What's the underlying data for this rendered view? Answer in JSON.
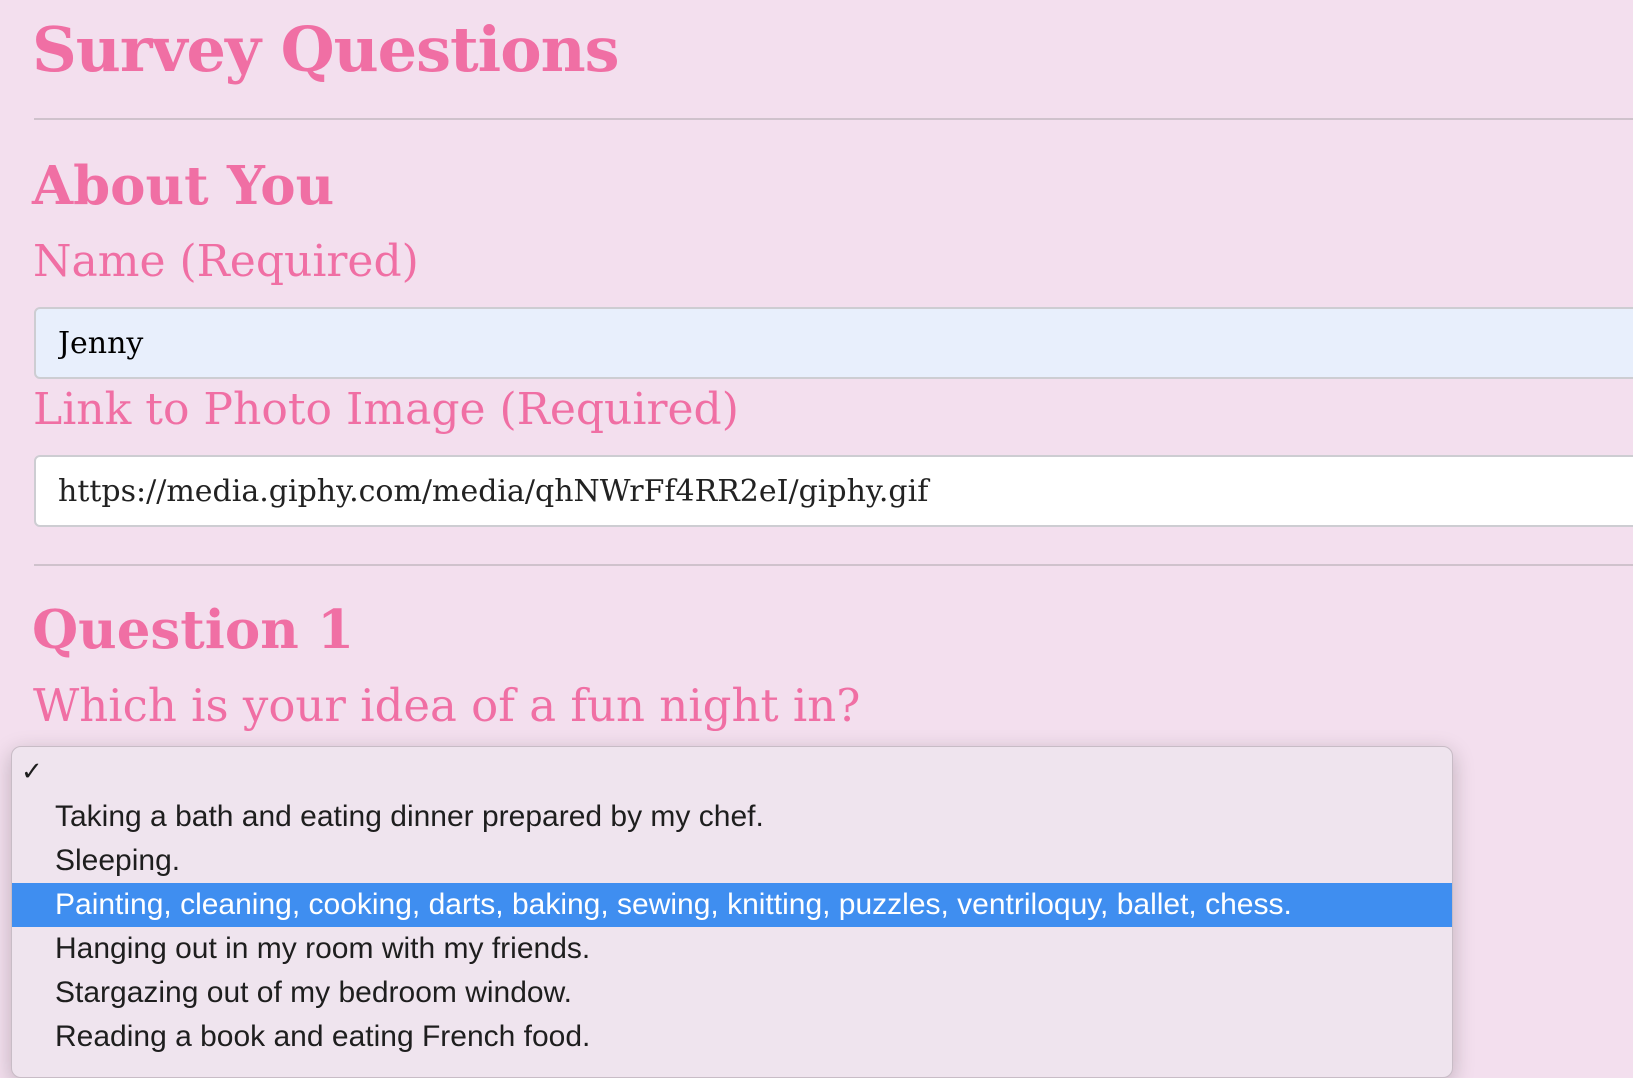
{
  "page": {
    "title": "Survey Questions"
  },
  "about": {
    "heading": "About You",
    "name_label": "Name (Required)",
    "name_value": "Jenny",
    "photo_label": "Link to Photo Image (Required)",
    "photo_value": "https://media.giphy.com/media/qhNWrFf4RR2eI/giphy.gif"
  },
  "question1": {
    "heading": "Question 1",
    "prompt": "Which is your idea of a fun night in?",
    "dropdown": {
      "checked_symbol": "✓",
      "options": [
        {
          "label": ""
        },
        {
          "label": "Taking a bath and eating dinner prepared by my chef."
        },
        {
          "label": "Sleeping."
        },
        {
          "label": "Painting, cleaning, cooking, darts, baking, sewing, knitting, puzzles, ventriloquy, ballet, chess."
        },
        {
          "label": "Hanging out in my room with my friends."
        },
        {
          "label": "Stargazing out of my bedroom window."
        },
        {
          "label": "Reading a book and eating French food."
        }
      ]
    }
  },
  "colors": {
    "accent": "#f06fa4",
    "background": "#f3dfee",
    "highlight": "#3f8ef0",
    "name_input_bg": "#e8effc"
  }
}
